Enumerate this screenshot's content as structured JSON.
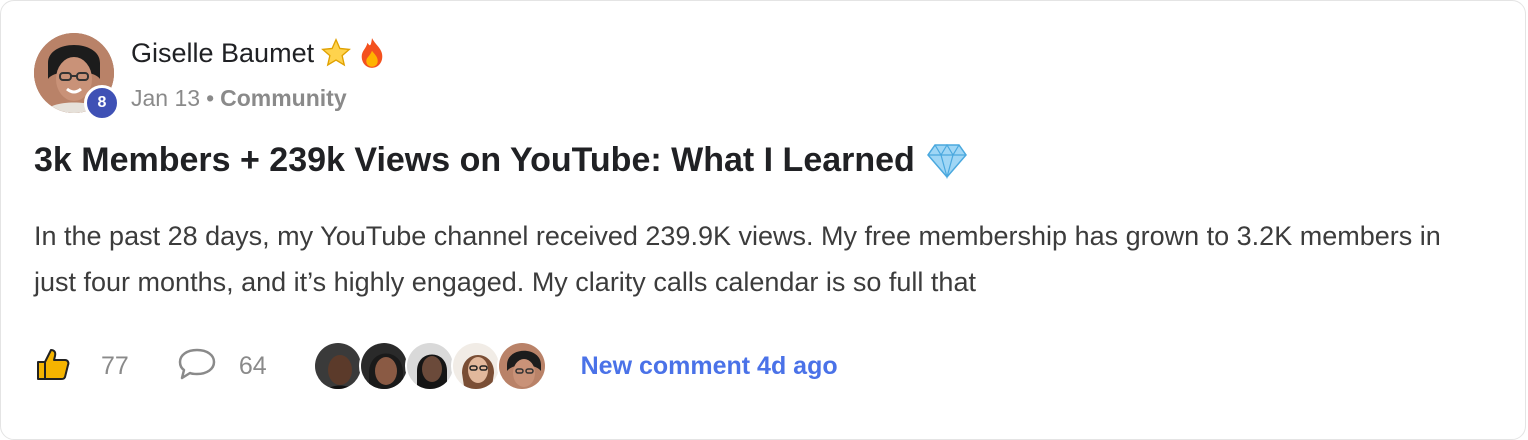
{
  "post": {
    "author": {
      "name": "Giselle Baumet",
      "level": "8",
      "avatar_icon": "avatar-photo",
      "badges": [
        "star-icon",
        "fire-icon"
      ]
    },
    "date": "Jan 13",
    "separator": "•",
    "category": "Community",
    "title": "3k Members + 239k Views on YouTube: What I Learned",
    "title_emoji": "gem-icon",
    "body": "In the past 28 days, my YouTube channel received 239.9K views. My free membership has grown to 3.2K members in just four months, and it’s highly engaged. My clarity calls calendar is so full that",
    "likes": "77",
    "comments": "64",
    "commenter_avatars": [
      "commenter-1",
      "commenter-2",
      "commenter-3",
      "commenter-4",
      "commenter-5"
    ],
    "new_comment": "New comment 4d ago"
  },
  "colors": {
    "level_badge": "#3f51b5",
    "link": "#4a72e8",
    "muted": "#8a8a8a",
    "like_icon": "#f5b400"
  }
}
